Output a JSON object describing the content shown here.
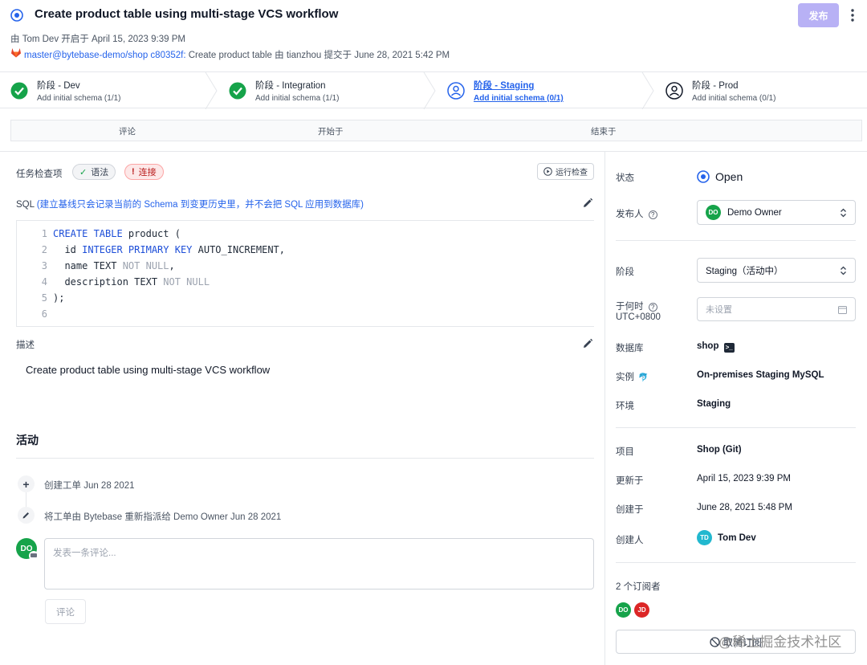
{
  "header": {
    "title": "Create product table using multi-stage VCS workflow",
    "opened_by": "由 Tom Dev 开启于 April 15, 2023 9:39 PM",
    "commit_ref": "master@bytebase-demo/shop c80352f:",
    "commit_msg": "Create product table 由 tianzhou 提交于 June 28, 2021 5:42 PM",
    "publish_label": "发布"
  },
  "stages": [
    {
      "name": "阶段 - Dev",
      "task": "Add initial schema (1/1)",
      "status": "done"
    },
    {
      "name": "阶段 - Integration",
      "task": "Add initial schema (1/1)",
      "status": "done"
    },
    {
      "name": "阶段 - Staging",
      "task": "Add initial schema (0/1)",
      "status": "active"
    },
    {
      "name": "阶段 - Prod",
      "task": "Add initial schema (0/1)",
      "status": "pending"
    }
  ],
  "tabs": [
    "评论",
    "开始于",
    "结束于"
  ],
  "checks": {
    "label": "任务检查项",
    "syntax": "语法",
    "connection": "连接",
    "run_label": "运行检查"
  },
  "sql": {
    "label": "SQL",
    "note": "(建立基线只会记录当前的 Schema 到变更历史里，并不会把 SQL 应用到数据库)",
    "line_numbers": [
      "1",
      "2",
      "3",
      "4",
      "5",
      "6"
    ]
  },
  "description": {
    "label": "描述",
    "text": "Create product table using multi-stage VCS workflow"
  },
  "activity": {
    "title": "活动",
    "items": [
      "创建工单 Jun 28 2021",
      "将工单由 Bytebase 重新指派给 Demo Owner Jun 28 2021"
    ],
    "comment_placeholder": "发表一条评论...",
    "comment_button": "评论",
    "user_initials": "DO"
  },
  "sidebar": {
    "status_label": "状态",
    "status_value": "Open",
    "assignee_label": "发布人",
    "assignee_initials": "DO",
    "assignee_name": "Demo Owner",
    "stage_label": "阶段",
    "stage_value": "Staging（活动中）",
    "when_label": "于何时",
    "timezone": "UTC+0800",
    "when_placeholder": "未设置",
    "database_label": "数据库",
    "database_value": "shop",
    "instance_label": "实例",
    "instance_value": "On-premises Staging MySQL",
    "env_label": "环境",
    "env_value": "Staging",
    "project_label": "项目",
    "project_value": "Shop (Git)",
    "updated_label": "更新于",
    "updated_value": "April 15, 2023 9:39 PM",
    "created_label": "创建于",
    "created_value": "June 28, 2021 5:48 PM",
    "creator_label": "创建人",
    "creator_initials": "TD",
    "creator_name": "Tom Dev",
    "subscribers_label": "2 个订阅者",
    "subscribers": [
      "DO",
      "JD"
    ],
    "unsubscribe_label": "取消订阅"
  },
  "watermark": "@稀土掘金技术社区",
  "colors": {
    "accent": "#2563eb",
    "success": "#16a34a",
    "publish": "#b8b1f5",
    "danger": "#dc2626"
  }
}
